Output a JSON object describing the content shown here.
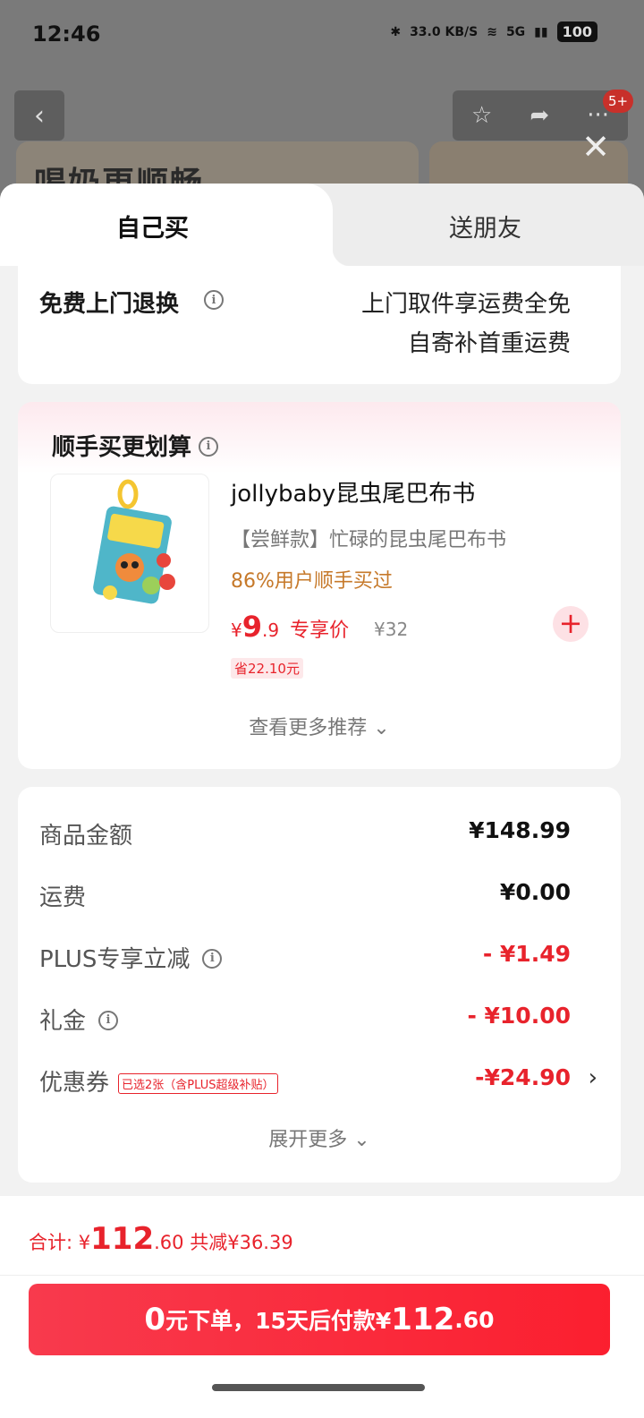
{
  "status_bar": {
    "time": "12:46",
    "net_speed": "33.0",
    "net_unit": "KB/S",
    "signal": "5G",
    "battery": "100"
  },
  "background_page": {
    "banner_text": "喝奶更顺畅",
    "badge": "5+"
  },
  "tabs": {
    "self": "自己买",
    "gift": "送朋友"
  },
  "return_service": {
    "title": "免费上门退换",
    "line1": "上门取件享运费全免",
    "line2": "自寄补首重运费"
  },
  "addon": {
    "title": "顺手买更划算",
    "product_name": "jollybaby昆虫尾巴布书",
    "product_sub": "【尝鲜款】忙碌的昆虫尾巴布书",
    "buyers": "86%用户顺手买过",
    "price_symbol": "¥",
    "price_int": "9",
    "price_dec": ".9",
    "price_tag": "专享价",
    "orig_price": "¥32",
    "save": "省22.10元",
    "more": "查看更多推荐"
  },
  "pricing": {
    "rows": [
      {
        "label": "商品金额",
        "value": "¥148.99"
      },
      {
        "label": "运费",
        "value": "¥0.00"
      },
      {
        "label": "PLUS专享立减",
        "value": "- ¥1.49"
      },
      {
        "label": "礼金",
        "value": "- ¥10.00"
      },
      {
        "label": "优惠券",
        "tag": "已选2张（含PLUS超级补贴）",
        "value": "-¥24.90"
      }
    ],
    "expand": "展开更多"
  },
  "footer": {
    "total_label": "合计:",
    "total_symbol": "¥",
    "total_int": "112",
    "total_dec": ".60",
    "saved": "共减¥36.39",
    "pay_zero": "0",
    "pay_text1": "元下单，15天后付款¥",
    "pay_int": "112",
    "pay_dec": ".60"
  },
  "colors": {
    "accent": "#e8232c",
    "buyers": "#c6792a",
    "pay_button": "#f83a4d"
  }
}
